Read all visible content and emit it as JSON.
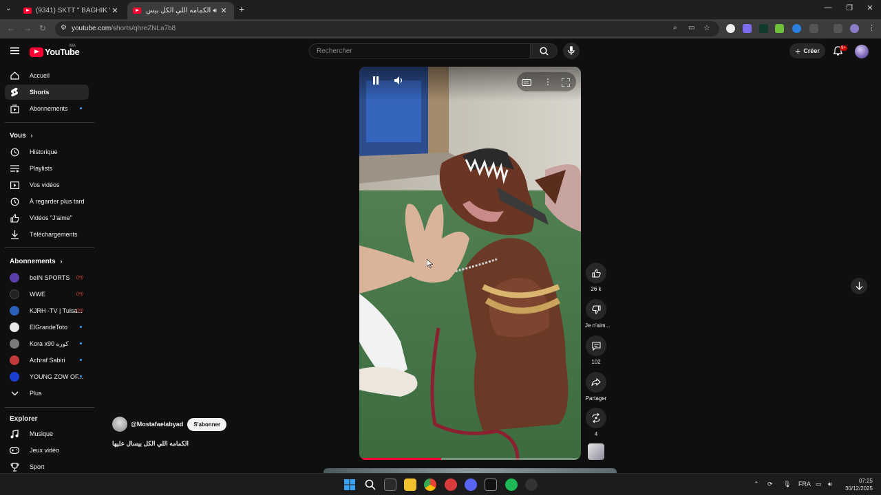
{
  "browser": {
    "tabs": [
      {
        "title": "(9341) SKTT \" BAGHIK \" Ft ILY (",
        "active": false
      },
      {
        "title": "الكمامه اللي الكل بيس (9341)",
        "active": true
      }
    ],
    "new_tab": "+",
    "url_host": "youtube.com",
    "url_path": "/shorts/qhreZNLa7b8"
  },
  "youtube": {
    "logo_text": "YouTube",
    "country_code": "MA",
    "search_placeholder": "Rechercher",
    "create_label": "Créer",
    "notifications_badge": "9+"
  },
  "sidebar": {
    "main": [
      {
        "label": "Accueil",
        "icon": "home-icon"
      },
      {
        "label": "Shorts",
        "icon": "shorts-icon",
        "selected": true
      },
      {
        "label": "Abonnements",
        "icon": "subscriptions-icon",
        "dot": true
      }
    ],
    "you_heading": "Vous",
    "you": [
      {
        "label": "Historique",
        "icon": "history-icon"
      },
      {
        "label": "Playlists",
        "icon": "playlists-icon"
      },
      {
        "label": "Vos vidéos",
        "icon": "your-videos-icon"
      },
      {
        "label": "À regarder plus tard",
        "icon": "watch-later-icon"
      },
      {
        "label": "Vidéos \"J'aime\"",
        "icon": "liked-icon"
      },
      {
        "label": "Téléchargements",
        "icon": "downloads-icon"
      }
    ],
    "subs_heading": "Abonnements",
    "subscriptions": [
      {
        "label": "beIN SPORTS",
        "color": "#5a3fa8",
        "status": "live"
      },
      {
        "label": "WWE",
        "color": "#222222",
        "status": "live"
      },
      {
        "label": "KJRH -TV | Tulsa...",
        "color": "#2b5fb8",
        "status": "live"
      },
      {
        "label": "ElGrandeToto",
        "color": "#e8e8e8",
        "status": "dot"
      },
      {
        "label": "Kora x90 كوره",
        "color": "#7a7a7a",
        "status": "dot"
      },
      {
        "label": "Achraf Sabiri",
        "color": "#c43a3a",
        "status": "dot"
      },
      {
        "label": "YOUNG ZOW OF...",
        "color": "#1d3fd1",
        "status": "dot"
      }
    ],
    "more_label": "Plus",
    "explore_heading": "Explorer",
    "explore": [
      {
        "label": "Musique",
        "icon": "music-icon"
      },
      {
        "label": "Jeux vidéo",
        "icon": "gaming-icon"
      },
      {
        "label": "Sport",
        "icon": "trophy-icon"
      }
    ]
  },
  "short": {
    "channel": "@Mostafaelabyad",
    "subscribe_label": "S'abonner",
    "title": "الكمامه اللي الكل بيسال عليها",
    "progress": 0.37,
    "actions": {
      "like_count": "26 k",
      "dislike_label": "Je n'aim...",
      "comments_count": "102",
      "share_label": "Partager",
      "remix_count": "4"
    }
  },
  "taskbar": {
    "language": "FRA",
    "time": "07:25",
    "date": "30/12/2025"
  }
}
